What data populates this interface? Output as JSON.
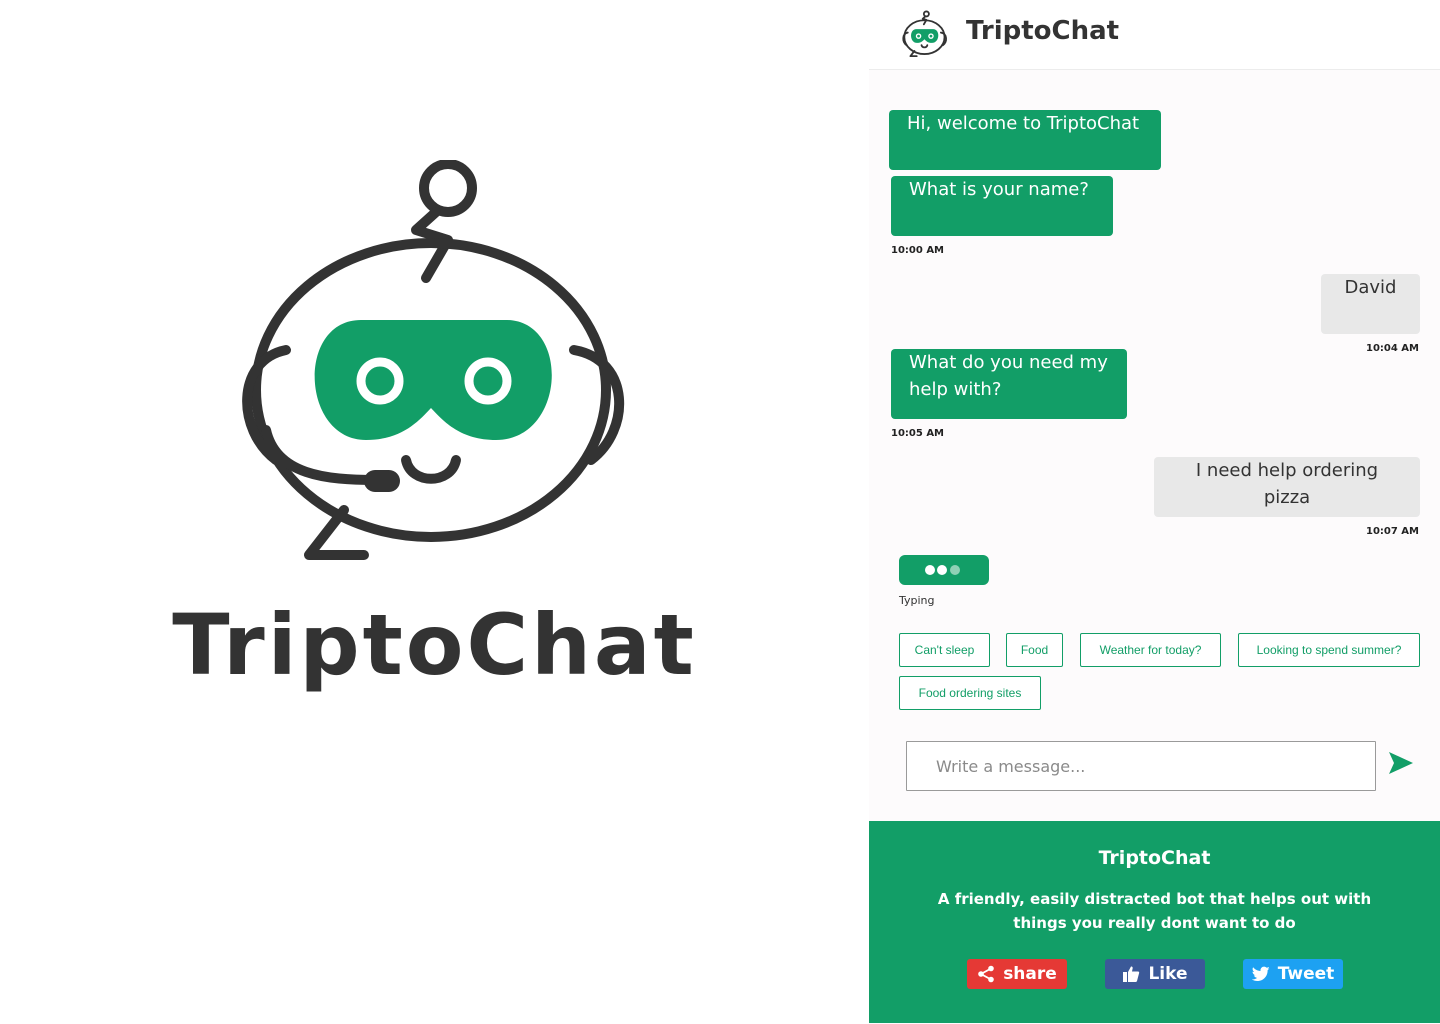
{
  "app": {
    "name": "TriptoChat",
    "brand_color": "#129e67",
    "text_color": "#333333"
  },
  "hero": {
    "title": "TriptoChat",
    "logo_icon": "robot-chat-icon"
  },
  "header": {
    "title": "TriptoChat",
    "logo_icon": "robot-chat-icon"
  },
  "messages": [
    {
      "sender": "bot",
      "text": "Hi, welcome to TriptoChat"
    },
    {
      "sender": "bot",
      "text": "What is your name?",
      "time": "10:00 AM"
    },
    {
      "sender": "user",
      "text": "David",
      "time": "10:04 AM"
    },
    {
      "sender": "bot",
      "text": "What do you need my\n help with?",
      "time": "10:05 AM"
    },
    {
      "sender": "user",
      "text": "I need help ordering pizza",
      "time": "10:07 AM"
    }
  ],
  "typing": {
    "label": "Typing"
  },
  "quick_replies": [
    "Can't sleep",
    "Food",
    "Weather for today?",
    "Looking to spend summer?",
    "Food ordering sites"
  ],
  "composer": {
    "placeholder": "Write a message...",
    "value": "",
    "send_icon": "send-icon"
  },
  "footer": {
    "title": "TriptoChat",
    "description": "A friendly, easily distracted bot that helps out with things you really dont want to do",
    "buttons": [
      {
        "label": "share",
        "icon": "share-icon",
        "color": "#e53935"
      },
      {
        "label": "Like",
        "icon": "thumbs-up-icon",
        "color": "#3b5998"
      },
      {
        "label": "Tweet",
        "icon": "twitter-bird-icon",
        "color": "#1da1f2"
      }
    ]
  }
}
